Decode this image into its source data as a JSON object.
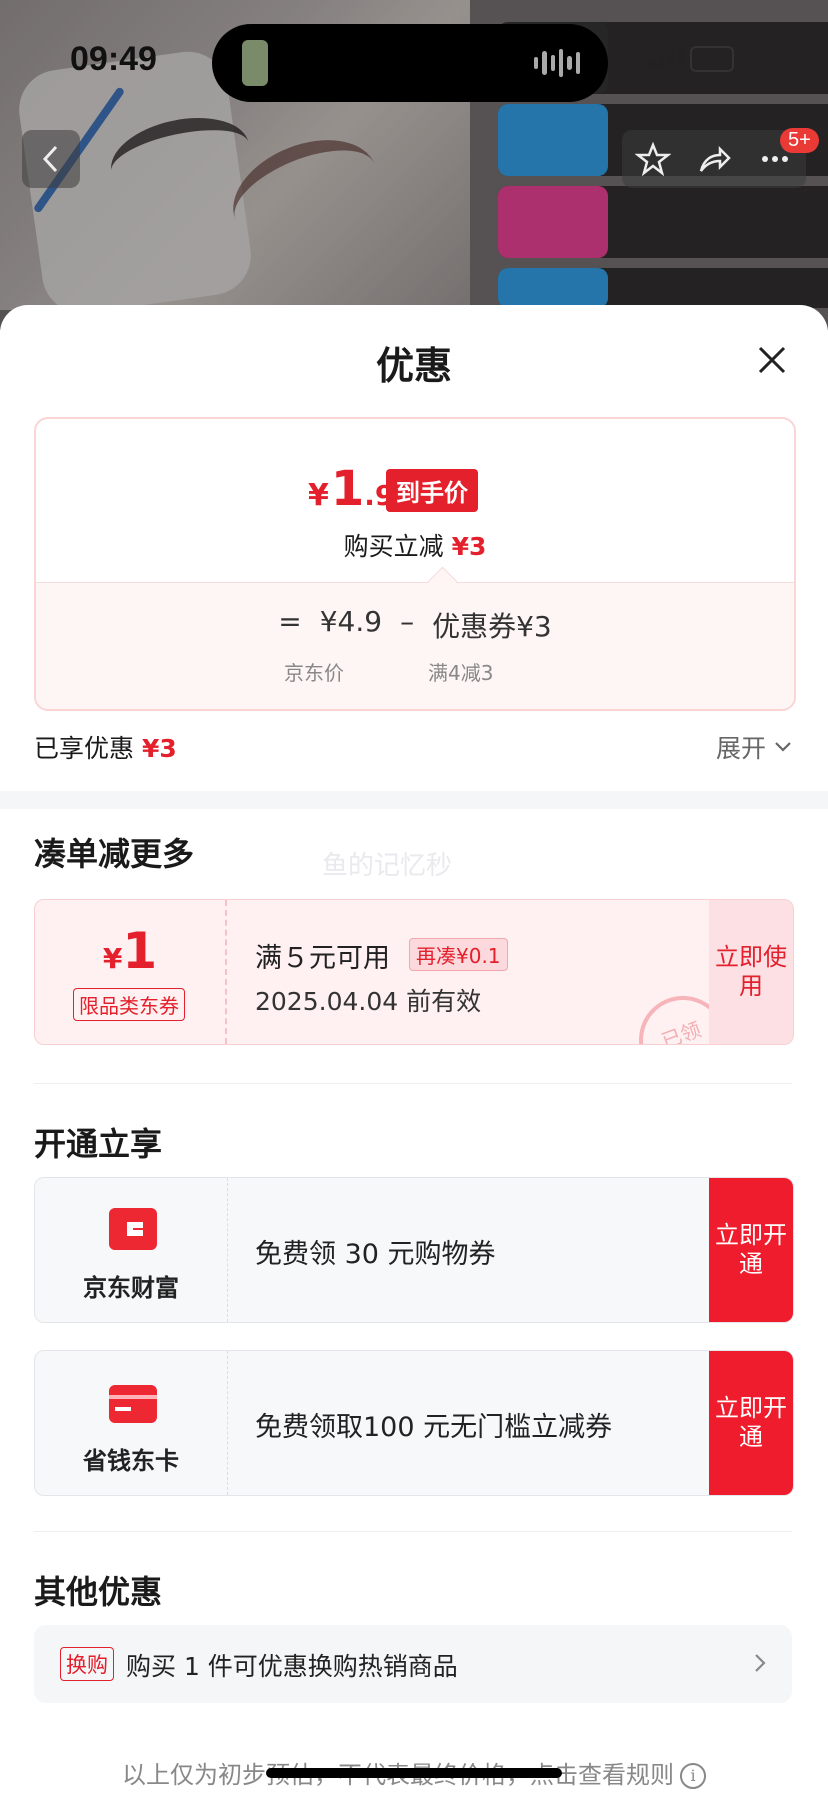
{
  "status_bar": {
    "time": "09:49"
  },
  "header": {
    "badge": "5+"
  },
  "sheet": {
    "title": "优惠",
    "price": {
      "yen": "¥",
      "integer": "1",
      "decimal": ".9",
      "tag": "到手价"
    },
    "instant_cut": {
      "label": "购买立减",
      "value": "¥3"
    },
    "formula": {
      "equals": "=",
      "jd_price": "¥4.9",
      "minus": "–",
      "coupon": "优惠券¥3"
    },
    "formula_sub": {
      "jd_price_label": "京东价",
      "coupon_rule": "满4减3"
    },
    "enjoyed": {
      "label": "已享优惠",
      "value": "¥3"
    },
    "expand_label": "展开"
  },
  "combine": {
    "title": "凑单减更多",
    "watermark": "鱼的记忆秒",
    "coupon": {
      "yen": "¥",
      "amount": "1",
      "kind": "限品类东券",
      "condition": "满５元可用",
      "more": "再凑¥0.1",
      "valid": "2025.04.04 前有效",
      "stamp": "已领",
      "action": "立即使用"
    }
  },
  "activate": {
    "title": "开通立享",
    "items": [
      {
        "label": "京东财富",
        "desc": "免费领 30 元购物券",
        "action": "立即开通"
      },
      {
        "label": "省钱东卡",
        "desc": "免费领取100 元无门槛立减券",
        "action": "立即开通"
      }
    ]
  },
  "other": {
    "title": "其他优惠",
    "tag": "换购",
    "text": "购买 1 件可优惠换购热销商品"
  },
  "footer": {
    "text": "以上仅为初步预估，不代表最终价格，点击查看规则",
    "info": "i"
  },
  "colors": {
    "accent": "#e4202c",
    "button_red": "#ee1c2c",
    "coupon_bg": "#fff0f1"
  }
}
